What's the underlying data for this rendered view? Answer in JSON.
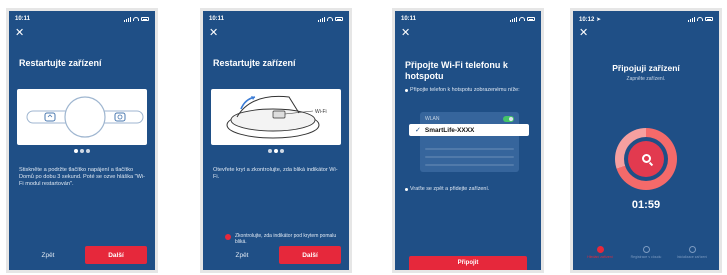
{
  "phones": [
    {
      "time": "10:11",
      "title": "Restartujte zařízení",
      "body": "Stiskněte a podržte tlačítko napájení a tlačítko Domů po dobu 3 sekund. Poté se ozve hláška \"Wi-Fi modul restartován\".",
      "back_label": "Zpět",
      "next_label": "Další"
    },
    {
      "time": "10:11",
      "title": "Restartujte zařízení",
      "illustration_label": "Wi-Fi",
      "body": "Otevřete kryt a zkontrolujte, zda bliká indikátor Wi-Fi.",
      "checkbox_label": "Zkontrolujte, zda indikátor pod krytem pomalu bliká.",
      "back_label": "Zpět",
      "next_label": "Další"
    },
    {
      "time": "10:11",
      "title": "Připojte Wi-Fi telefonu k hotspotu",
      "instruction": "Připojte telefon k hotspotu zobrazenému níže:",
      "wlan_label": "WLAN",
      "network_name": "SmartLife-XXXX",
      "return_text": "Vraťte se zpět a přidejte zařízení.",
      "connect_label": "Připojit"
    },
    {
      "time": "10:12",
      "title": "Připojuji zařízení",
      "subtitle": "Zapněte zařízení.",
      "timer": "01:59",
      "progress_fraction": 0.7,
      "steps": [
        "Hledání zařízení",
        "Registrace v cloudu",
        "Inicializace zařízení"
      ]
    }
  ],
  "colors": {
    "screen_bg": "#1f4f86",
    "accent_red": "#e6283b",
    "frame": "#e6e6e6"
  }
}
